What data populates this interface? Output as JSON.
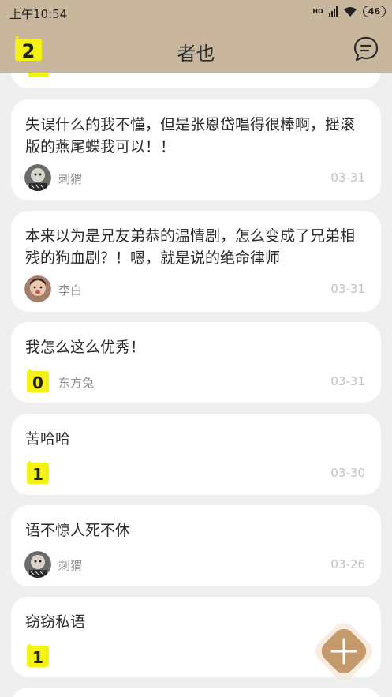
{
  "status_bar": {
    "time": "上午10:54",
    "battery": "46",
    "hd_label": "HD"
  },
  "header": {
    "title": "者也",
    "left_badge_number": "2"
  },
  "posts": [
    {
      "text": "失误什么的我不懂，但是张恩岱唱得很棒啊，摇滚版的燕尾蝶我可以！！",
      "author": "刺猬",
      "date": "03-31",
      "avatar": "hedgehog-avatar"
    },
    {
      "text": "本来以为是兄友弟恭的温情剧，怎么变成了兄弟相残的狗血剧？！嗯，就是说的绝命律师",
      "author": "李白",
      "date": "03-31",
      "avatar": "child-avatar"
    },
    {
      "text": "我怎么这么优秀！",
      "author": "东方兔",
      "date": "03-31",
      "avatar": "sticker-0",
      "avatar_number": "0"
    },
    {
      "text": "苦哈哈",
      "author": "",
      "date": "03-30",
      "avatar": "sticker-1",
      "avatar_number": "1"
    },
    {
      "text": "语不惊人死不休",
      "author": "刺猬",
      "date": "03-26",
      "avatar": "hedgehog-avatar"
    },
    {
      "text": "窃窃私语",
      "author": "",
      "date": "",
      "avatar": "sticker-1",
      "avatar_number": "1"
    }
  ],
  "colors": {
    "header_bg": "#c8b79c",
    "feed_bg": "#efefef",
    "card_bg": "#ffffff",
    "fab": "#c49a6c",
    "sticker_yellow": "#f3f213"
  },
  "icons": {
    "compose_fab": "plus-icon",
    "messages": "chat-bubble-icon"
  }
}
